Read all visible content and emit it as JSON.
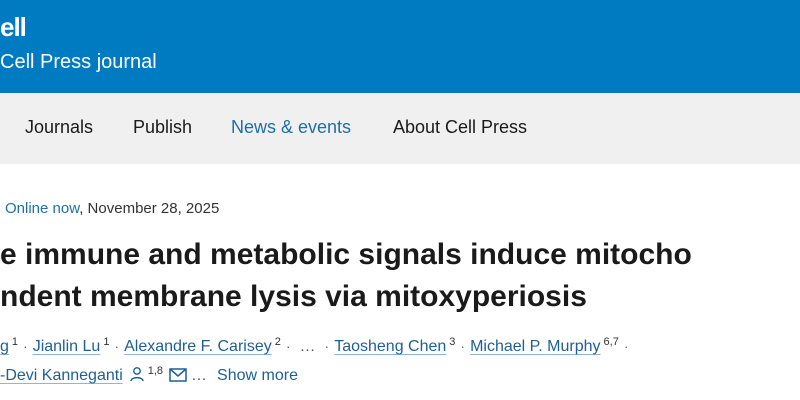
{
  "header": {
    "brand": "ell",
    "subtitle": "Cell Press journal"
  },
  "nav": {
    "items": [
      {
        "label": "Journals"
      },
      {
        "label": "Publish"
      },
      {
        "label": "News & events"
      },
      {
        "label": "About Cell Press"
      }
    ]
  },
  "article": {
    "status": "Online now",
    "date": ", November 28, 2025",
    "title_line1": "e immune and metabolic signals induce mitocho",
    "title_line2": "ndent membrane lysis via mitoxyperiosis",
    "authors_line1": [
      {
        "name": "g",
        "sup": "1"
      },
      {
        "name": "Jianlin Lu",
        "sup": "1"
      },
      {
        "name": "Alexandre F. Carisey",
        "sup": "2"
      },
      {
        "name": "Taosheng Chen",
        "sup": "3"
      },
      {
        "name": "Michael P. Murphy",
        "sup": "6,7"
      }
    ],
    "ellipsis": "…",
    "authors_line2": {
      "name": "-Devi Kanneganti",
      "sup": "1,8",
      "show_more": "Show more"
    }
  },
  "colors": {
    "banner": "#007bc2",
    "link": "#1f5f94",
    "nav_bg": "#f0f0f0"
  }
}
